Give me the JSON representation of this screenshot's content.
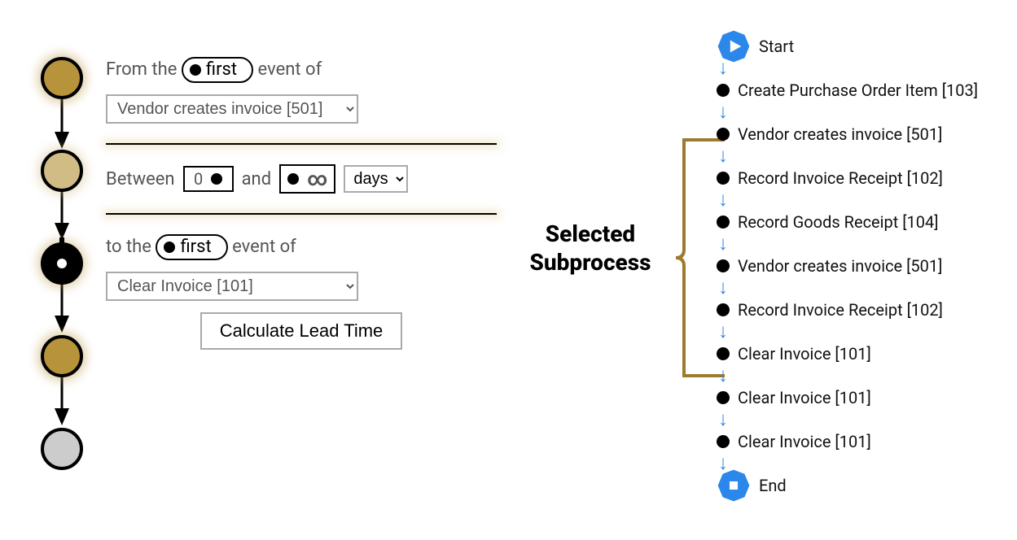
{
  "left": {
    "from_prefix": "From the",
    "from_pill": "first",
    "from_suffix": "event of",
    "from_select": "Vendor creates invoice [501]",
    "between_prefix": "Between",
    "between_min": "0",
    "between_and": "and",
    "between_max": "∞",
    "unit": "days",
    "to_prefix": "to the",
    "to_pill": "first",
    "to_suffix": "event of",
    "to_select": "Clear Invoice [101]",
    "calc_button": "Calculate Lead Time"
  },
  "middle_label_line1": "Selected",
  "middle_label_line2": "Subprocess",
  "flow": {
    "start": "Start",
    "end": "End",
    "steps": [
      "Create Purchase Order Item [103]",
      "Vendor creates invoice [501]",
      "Record Invoice Receipt [102]",
      "Record Goods Receipt [104]",
      "Vendor creates invoice [501]",
      "Record Invoice Receipt [102]",
      "Clear Invoice [101]",
      "Clear Invoice [101]",
      "Clear Invoice [101]"
    ],
    "bracket_start_index": 1,
    "bracket_end_index": 6
  }
}
